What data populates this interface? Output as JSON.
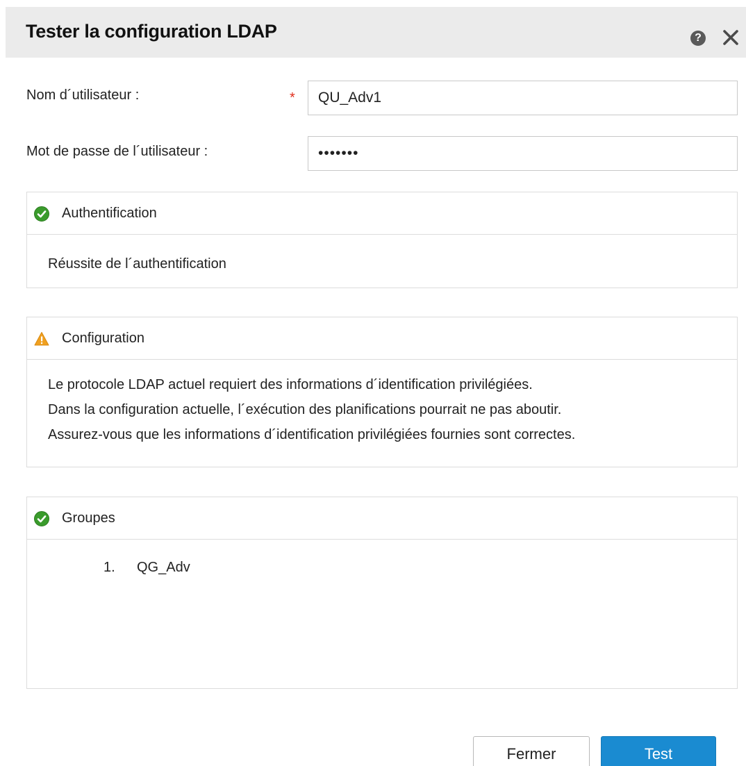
{
  "dialog": {
    "title": "Tester la configuration LDAP",
    "help_icon": "question-circle-icon",
    "help_glyph": "?",
    "close_icon": "close-x-icon"
  },
  "form": {
    "username_label": "Nom d´utilisateur :",
    "username_required_mark": "*",
    "username_value": "QU_Adv1",
    "password_label": "Mot de passe de l´utilisateur :",
    "password_value": "•••••••"
  },
  "panels": {
    "authentication": {
      "status_icon": "check-circle-icon",
      "title": "Authentification",
      "lines": [
        "Réussite de l´authentification"
      ]
    },
    "configuration": {
      "status_icon": "warning-triangle-icon",
      "title": "Configuration",
      "lines": [
        "Le protocole LDAP actuel requiert des informations d´identification privilégiées.",
        "Dans la configuration actuelle, l´exécution des planifications pourrait ne pas aboutir.",
        "Assurez-vous que les informations d´identification privilégiées fournies sont correctes."
      ]
    },
    "groups": {
      "status_icon": "check-circle-icon",
      "title": "Groupes",
      "items": [
        {
          "number": "1.",
          "name": "QG_Adv"
        }
      ]
    }
  },
  "buttons": {
    "close_label": "Fermer",
    "test_label": "Test"
  },
  "colors": {
    "primary_button": "#1a8bd1",
    "success_icon": "#3a9b2c",
    "warning_icon": "#f0a020",
    "required_mark": "#e0301e",
    "titlebar_bg": "#ebebeb"
  }
}
